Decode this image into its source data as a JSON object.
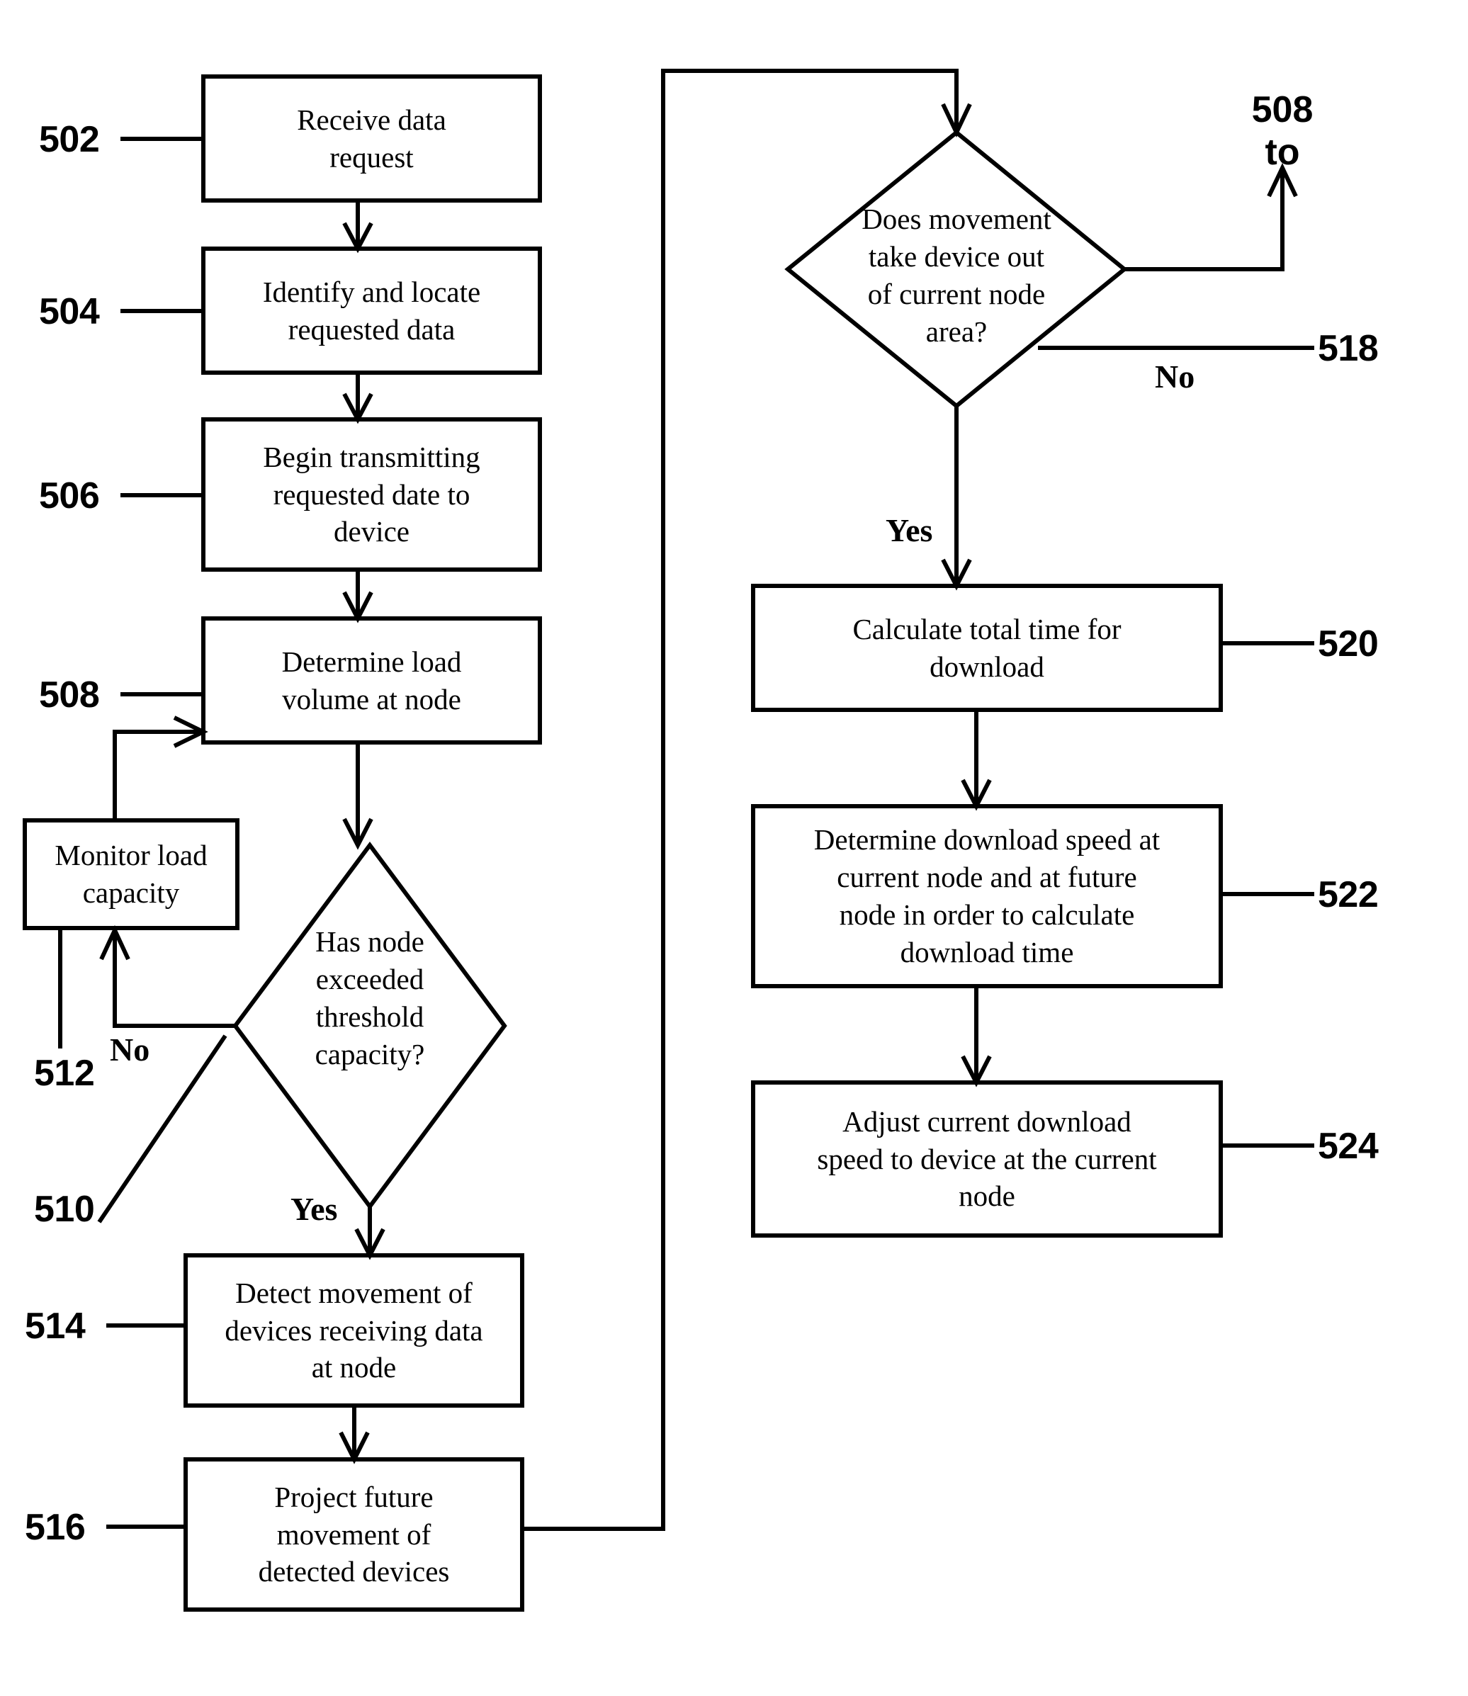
{
  "diagram": {
    "kind": "patent-flowchart",
    "nodes": {
      "n502": {
        "ref": "502",
        "text": "Receive data\nrequest",
        "shape": "process"
      },
      "n504": {
        "ref": "504",
        "text": "Identify and locate\nrequested data",
        "shape": "process"
      },
      "n506": {
        "ref": "506",
        "text": "Begin transmitting\nrequested date to\ndevice",
        "shape": "process"
      },
      "n508": {
        "ref": "508",
        "text": "Determine load\nvolume at node",
        "shape": "process"
      },
      "n510": {
        "ref": "510",
        "text": "Has node\nexceeded\nthreshold\ncapacity?",
        "shape": "decision"
      },
      "n512": {
        "ref": "512",
        "text": "Monitor load\ncapacity",
        "shape": "process"
      },
      "n514": {
        "ref": "514",
        "text": "Detect movement of\ndevices receiving data\nat node",
        "shape": "process"
      },
      "n516": {
        "ref": "516",
        "text": "Project future\nmovement of\ndetected devices",
        "shape": "process"
      },
      "n518": {
        "ref": "518",
        "text": "Does movement\ntake device out\nof  current node\narea?",
        "shape": "decision"
      },
      "n520": {
        "ref": "520",
        "text": "Calculate total time for\ndownload",
        "shape": "process"
      },
      "n522": {
        "ref": "522",
        "text": "Determine download speed at\ncurrent node and at future\nnode in order to calculate\ndownload time",
        "shape": "process"
      },
      "n524": {
        "ref": "524",
        "text": "Adjust current download\nspeed to device at the current\nnode",
        "shape": "process"
      }
    },
    "branch_labels": {
      "no_510": "No",
      "yes_510": "Yes",
      "no_518": "No",
      "yes_518": "Yes"
    },
    "offpage_connector": {
      "ref": "508",
      "word": "to"
    },
    "colors": {
      "line": "#000000",
      "fill": "#ffffff",
      "text": "#000000"
    }
  }
}
